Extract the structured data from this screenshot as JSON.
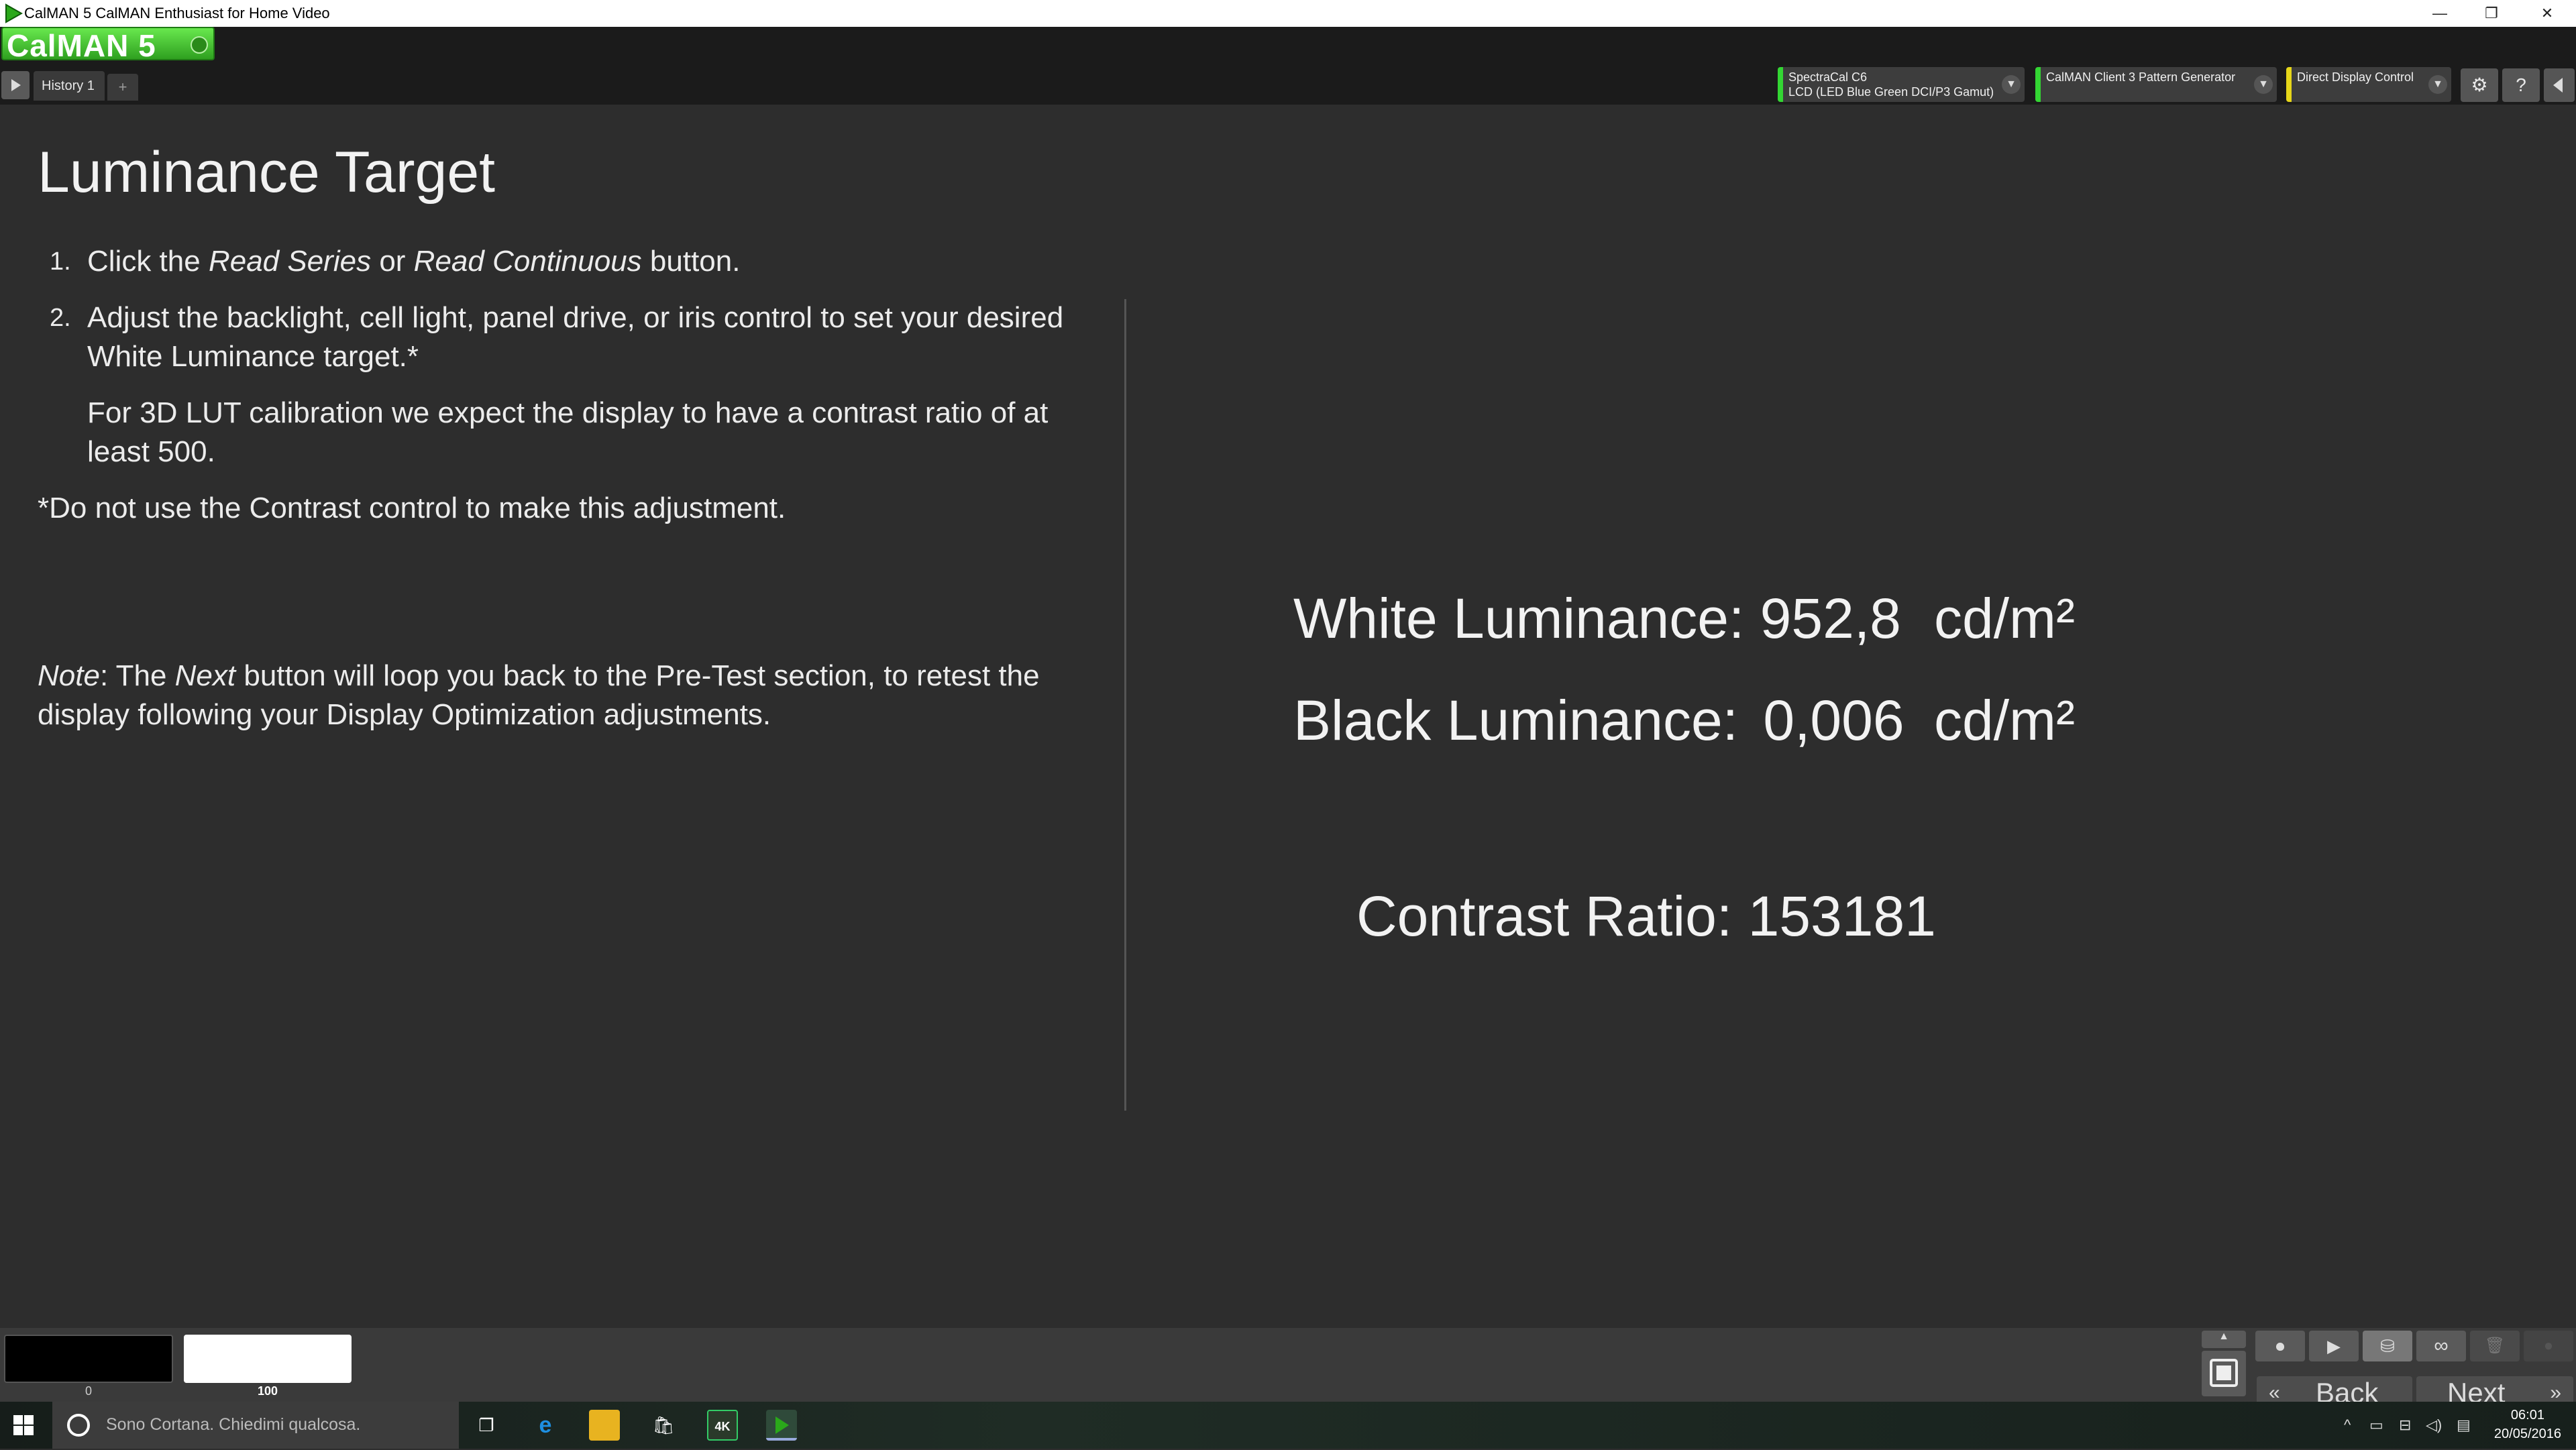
{
  "window": {
    "title": "CalMAN 5 CalMAN Enthusiast for Home Video",
    "minimize": "—",
    "restore": "❐",
    "close": "✕"
  },
  "app": {
    "logo_text": "CalMAN 5",
    "logo_color": "#46c832"
  },
  "history_tabs": [
    {
      "label": "History 1"
    }
  ],
  "history_add_label": "+",
  "devices": [
    {
      "line1": "SpectraCal C6",
      "line2": "LCD (LED Blue Green DCI/P3 Gamut)",
      "status_color": "#33d633"
    },
    {
      "line1": "CalMAN Client 3 Pattern Generator",
      "line2": "",
      "status_color": "#33d633"
    },
    {
      "line1": "Direct Display Control",
      "line2": "",
      "status_color": "#e6d619"
    }
  ],
  "toolbar_icons": [
    "gear-icon",
    "help-icon",
    "collapse-icon"
  ],
  "page": {
    "title": "Luminance Target",
    "steps": [
      {
        "num": "1.",
        "text_html": "Click the <i>Read Series</i> or <i>Read Continuous</i> button."
      },
      {
        "num": "2.",
        "text_html": "Adjust the backlight, cell light, panel drive, or iris control to set your desired White Luminance target.*"
      }
    ],
    "lut_note": "For 3D LUT calibration we expect the display to have a contrast ratio of at least 500.",
    "contrast_warning": "*Do not use the Contrast control to make this adjustment.",
    "note_html": "<i>Note</i>: The <i>Next</i> button will loop you back to the Pre-Test section, to retest the display following your Display Optimization adjustments."
  },
  "measurements": {
    "white_label": "White Luminance:",
    "white_value": "952,8",
    "black_label": "Black Luminance:",
    "black_value": "0,006",
    "unit": "cd/m²",
    "contrast_label": "Contrast Ratio:",
    "contrast_value": "153181"
  },
  "swatches": [
    {
      "label": "0",
      "color": "#000000"
    },
    {
      "label": "100",
      "color": "#ffffff"
    }
  ],
  "navigation": {
    "back_label": "Back",
    "next_label": "Next"
  },
  "taskbar": {
    "cortana_text": "Sono Cortana. Chiedimi qualcosa.",
    "time": "06:01",
    "date": "20/05/2016",
    "apps": [
      "task-view-icon",
      "edge-icon",
      "file-explorer-icon",
      "store-icon",
      "4k-app-icon",
      "calman-taskbar-icon"
    ]
  }
}
